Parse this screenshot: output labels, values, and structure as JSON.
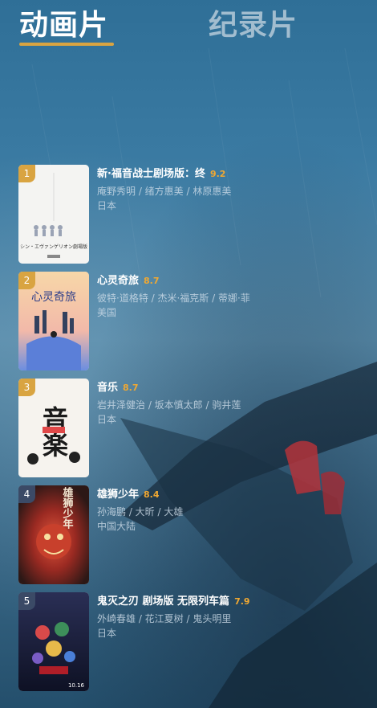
{
  "tabs": [
    {
      "label": "动画片",
      "active": true
    },
    {
      "label": "纪录片",
      "active": false
    }
  ],
  "accent_color": "#d9a441",
  "score_color": "#f0a832",
  "items": [
    {
      "rank": "1",
      "title": "新·福音战士剧场版：终",
      "score": "9.2",
      "people": "庵野秀明 / 绪方惠美 / 林原惠美",
      "region": "日本",
      "poster_text": "シン・エヴァンゲリオン劇場版"
    },
    {
      "rank": "2",
      "title": "心灵奇旅",
      "score": "8.7",
      "people": "彼特·道格特 / 杰米·福克斯 / 蒂娜·菲",
      "region": "美国",
      "poster_text": "心灵奇旅"
    },
    {
      "rank": "3",
      "title": "音乐",
      "score": "8.7",
      "people": "岩井泽健治 / 坂本慎太郎 / 驹井莲",
      "region": "日本",
      "poster_text": "音楽"
    },
    {
      "rank": "4",
      "title": "雄狮少年",
      "score": "8.4",
      "people": "孙海鹏 / 大昕 / 大雄",
      "region": "中国大陆",
      "poster_text": "雄狮少年"
    },
    {
      "rank": "5",
      "title": "鬼灭之刃 剧场版 无限列车篇",
      "score": "7.9",
      "people": "外崎春雄 / 花江夏树 / 鬼头明里",
      "region": "日本",
      "poster_text": "10.16"
    }
  ]
}
